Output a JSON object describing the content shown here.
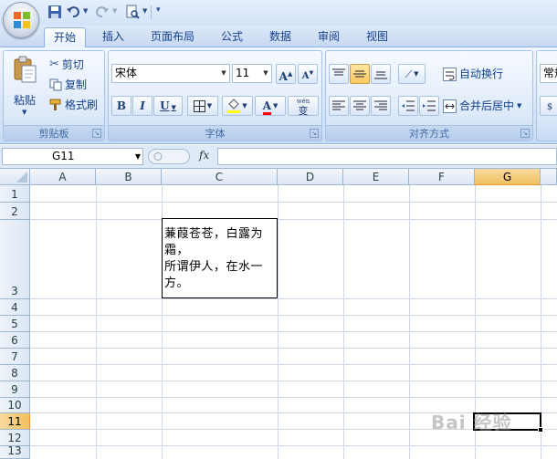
{
  "quick_access": {
    "icons": [
      "save-icon",
      "undo-icon",
      "redo-icon",
      "print-preview-icon",
      "customize-icon"
    ]
  },
  "tabs": [
    {
      "label": "开始",
      "active": true
    },
    {
      "label": "插入",
      "active": false
    },
    {
      "label": "页面布局",
      "active": false
    },
    {
      "label": "公式",
      "active": false
    },
    {
      "label": "数据",
      "active": false
    },
    {
      "label": "审阅",
      "active": false
    },
    {
      "label": "视图",
      "active": false
    }
  ],
  "ribbon": {
    "clipboard": {
      "paste": "粘贴",
      "cut": "剪切",
      "copy": "复制",
      "format_painter": "格式刷",
      "label": "剪贴板"
    },
    "font": {
      "name": "宋体",
      "size": "11",
      "bold": "B",
      "italic": "I",
      "underline": "U",
      "phonetic": "wén",
      "phonetic_char": "变",
      "label": "字体"
    },
    "alignment": {
      "wrap_text": "自动换行",
      "merge_center": "合并后居中",
      "label": "对齐方式"
    },
    "number": {
      "format": "常规"
    }
  },
  "formula_bar": {
    "name_box": "G11",
    "fx": "fx",
    "formula": ""
  },
  "sheet": {
    "columns": [
      "A",
      "B",
      "C",
      "D",
      "E",
      "F",
      "G"
    ],
    "selected_column": "G",
    "rows": [
      "1",
      "2",
      "3",
      "4",
      "5",
      "6",
      "7",
      "8",
      "9",
      "10",
      "11",
      "12",
      "13"
    ],
    "selected_row": "11",
    "cell_c3": "蒹葭苍苍，白露为\n霜，\n所谓伊人，在水一\n方。"
  },
  "watermark": "Bai 经验",
  "colors": {
    "accent": "#f1c15f",
    "ribbon": "#dbe8f9",
    "header": "#dce6f4",
    "gridline": "#d0d7e5"
  }
}
